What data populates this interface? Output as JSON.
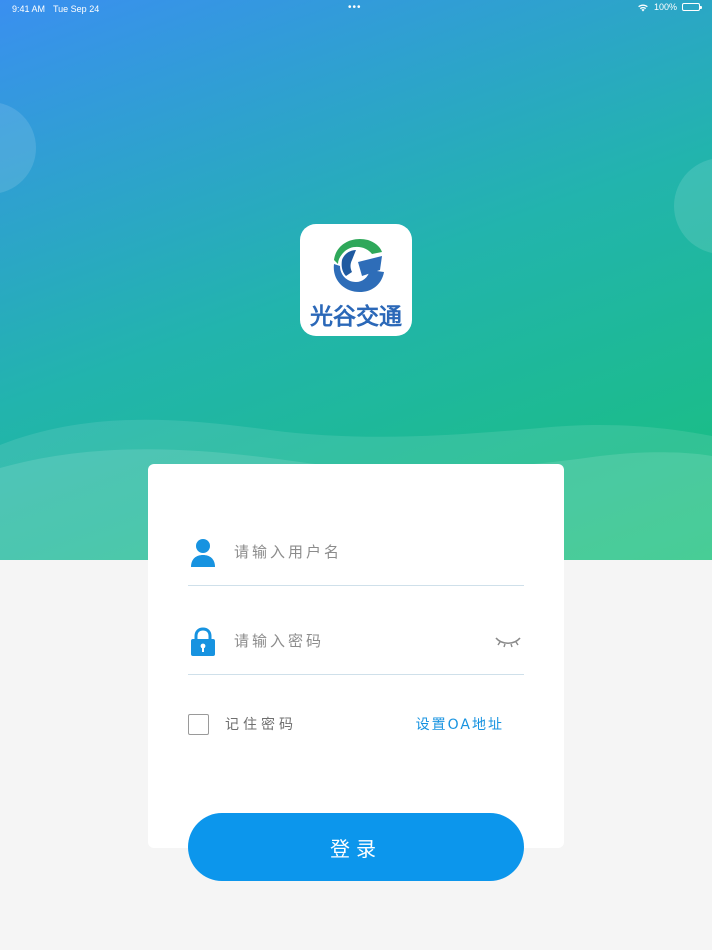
{
  "status_bar": {
    "time": "9:41 AM",
    "date": "Tue Sep 24",
    "dots": "•••",
    "battery_text": "100%"
  },
  "logo": {
    "text": "光谷交通"
  },
  "form": {
    "username_placeholder": "请输入用户名",
    "password_placeholder": "请输入密码",
    "remember_label": "记住密码",
    "remember_checked": false,
    "oa_link": "设置OA地址",
    "login_label": "登录"
  },
  "icons": {
    "user": "user-icon",
    "lock": "lock-icon",
    "eye": "eye-closed-icon",
    "wifi": "wifi-icon",
    "battery": "battery-icon"
  },
  "colors": {
    "primary": "#0c96ec",
    "link": "#1793e0",
    "gradient_start": "#3a8ff0",
    "gradient_end": "#18c07a",
    "background": "#f5f5f5"
  }
}
